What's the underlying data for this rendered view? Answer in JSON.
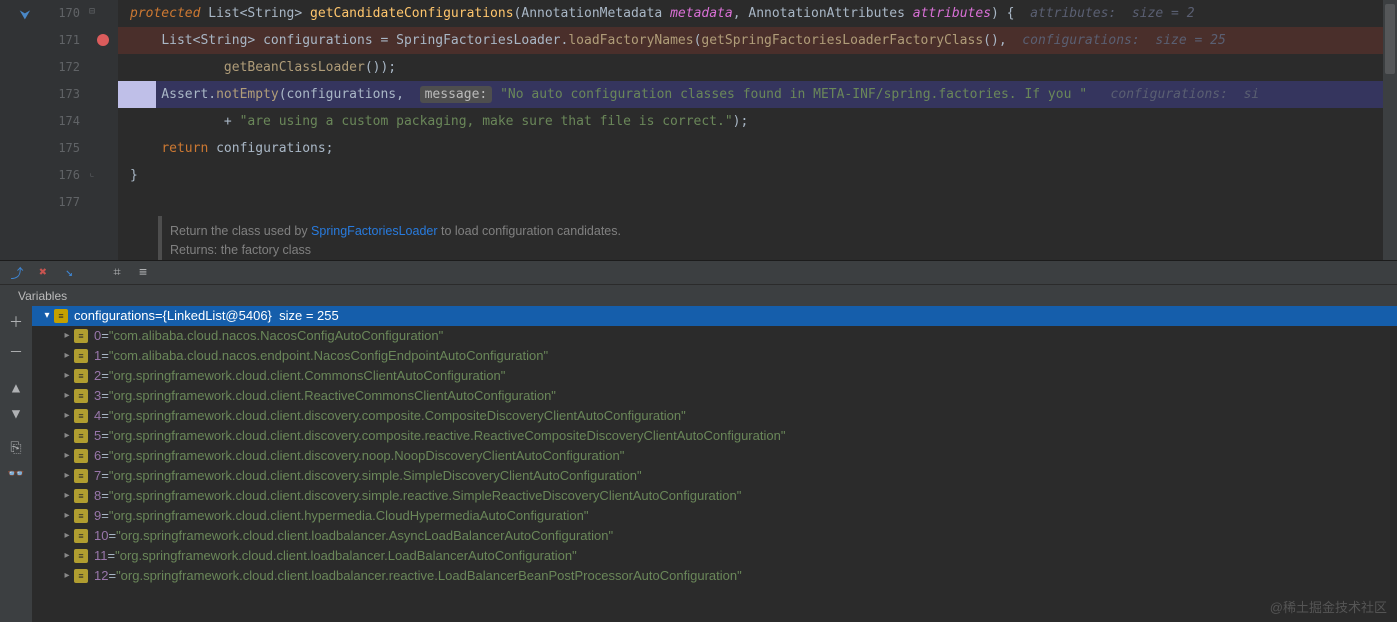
{
  "code": {
    "lines": [
      "170",
      "171",
      "172",
      "173",
      "174",
      "175",
      "176",
      "177"
    ],
    "l170": {
      "kw": "protected ",
      "type": "List",
      "generic": "String",
      "method": "getCandidateConfigurations",
      "p1_type": "AnnotationMetadata ",
      "p1_name": "metadata",
      "comma": ", ",
      "p2_type": "AnnotationAttributes ",
      "p2_name": "attributes",
      "end": ") {",
      "inlay": "  attributes:  size = 2"
    },
    "l171": {
      "indent": "    ",
      "type": "List",
      "generic": "String",
      "var": " configurations = ",
      "cls": "SpringFactoriesLoader",
      "dot": ".",
      "m1": "loadFactoryNames",
      "open": "(",
      "m2": "getSpringFactoriesLoaderFactoryClass",
      "close": "(),",
      "inlay": "  configurations:  size = 25"
    },
    "l172": {
      "indent": "            ",
      "m": "getBeanClassLoader",
      "close": "());"
    },
    "l173": {
      "indent": "    Assert.",
      "m": "notEmpty",
      "open": "(configurations,  ",
      "msg": "message:",
      "str": "\"No auto configuration classes found in META-INF/spring.factories. If you \"",
      "inlay": "   configurations:  si"
    },
    "l174": {
      "indent": "            + ",
      "str": "\"are using a custom packaging, make sure that file is correct.\"",
      "close": ");"
    },
    "l175": {
      "indent": "    ",
      "kw": "return",
      "var": " configurations;"
    },
    "l176": {
      "indent": "}"
    }
  },
  "doc": {
    "line1a": "Return the class used by ",
    "link": "SpringFactoriesLoader",
    "line1b": " to load configuration candidates.",
    "line2": "Returns: the factory class"
  },
  "vars": {
    "tab_label": "Variables",
    "root_name": "configurations",
    "root_obj": "{LinkedList@5406}",
    "root_size": "size = 255",
    "items": [
      {
        "idx": "0",
        "val": "\"com.alibaba.cloud.nacos.NacosConfigAutoConfiguration\""
      },
      {
        "idx": "1",
        "val": "\"com.alibaba.cloud.nacos.endpoint.NacosConfigEndpointAutoConfiguration\""
      },
      {
        "idx": "2",
        "val": "\"org.springframework.cloud.client.CommonsClientAutoConfiguration\""
      },
      {
        "idx": "3",
        "val": "\"org.springframework.cloud.client.ReactiveCommonsClientAutoConfiguration\""
      },
      {
        "idx": "4",
        "val": "\"org.springframework.cloud.client.discovery.composite.CompositeDiscoveryClientAutoConfiguration\""
      },
      {
        "idx": "5",
        "val": "\"org.springframework.cloud.client.discovery.composite.reactive.ReactiveCompositeDiscoveryClientAutoConfiguration\""
      },
      {
        "idx": "6",
        "val": "\"org.springframework.cloud.client.discovery.noop.NoopDiscoveryClientAutoConfiguration\""
      },
      {
        "idx": "7",
        "val": "\"org.springframework.cloud.client.discovery.simple.SimpleDiscoveryClientAutoConfiguration\""
      },
      {
        "idx": "8",
        "val": "\"org.springframework.cloud.client.discovery.simple.reactive.SimpleReactiveDiscoveryClientAutoConfiguration\""
      },
      {
        "idx": "9",
        "val": "\"org.springframework.cloud.client.hypermedia.CloudHypermediaAutoConfiguration\""
      },
      {
        "idx": "10",
        "val": "\"org.springframework.cloud.client.loadbalancer.AsyncLoadBalancerAutoConfiguration\""
      },
      {
        "idx": "11",
        "val": "\"org.springframework.cloud.client.loadbalancer.LoadBalancerAutoConfiguration\""
      },
      {
        "idx": "12",
        "val": "\"org.springframework.cloud.client.loadbalancer.reactive.LoadBalancerBeanPostProcessorAutoConfiguration\""
      }
    ]
  },
  "watermark": "@稀土掘金技术社区"
}
